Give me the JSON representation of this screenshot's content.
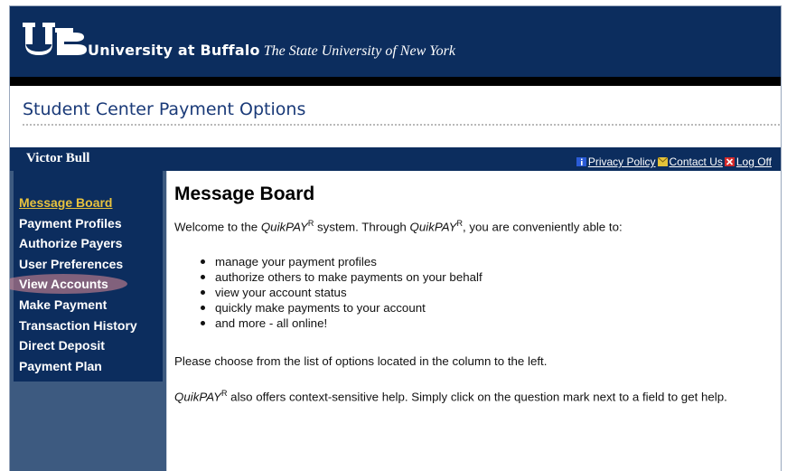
{
  "banner": {
    "university": "University at Buffalo",
    "tagline": "The State University of New York",
    "colors": {
      "navy": "#0c2d5e",
      "accent": "#e8c23d"
    }
  },
  "page": {
    "heading": "Student Center Payment Options"
  },
  "userbar": {
    "username": "Victor Bull",
    "links": [
      {
        "label": " Privacy Policy",
        "icon": "info-icon"
      },
      {
        "label": " Contact Us",
        "icon": "mail-icon"
      },
      {
        "label": " Log Off",
        "icon": "close-icon"
      }
    ]
  },
  "nav": {
    "items": [
      {
        "label": "Message Board"
      },
      {
        "label": "Payment Profiles"
      },
      {
        "label": "Authorize Payers"
      },
      {
        "label": "User Preferences"
      },
      {
        "label": "View Accounts"
      },
      {
        "label": "Make Payment"
      },
      {
        "label": "Transaction History"
      },
      {
        "label": "Direct Deposit"
      },
      {
        "label": "Payment Plan"
      }
    ]
  },
  "main": {
    "title": "Message Board",
    "brand": "QuikPAY",
    "reg": "R",
    "welcome_1": "Welcome to the ",
    "welcome_2": " system. Through ",
    "welcome_3": ", you are conveniently able to:",
    "bullets": [
      "manage your payment profiles",
      "authorize others to make payments on your behalf",
      "view your account status",
      "quickly make payments to your account",
      "and more - all online!"
    ],
    "choose": "Please choose from the list of options located in the column to the left.",
    "help_rest": " also offers context-sensitive help. Simply click on the question mark next to a field to get help."
  }
}
